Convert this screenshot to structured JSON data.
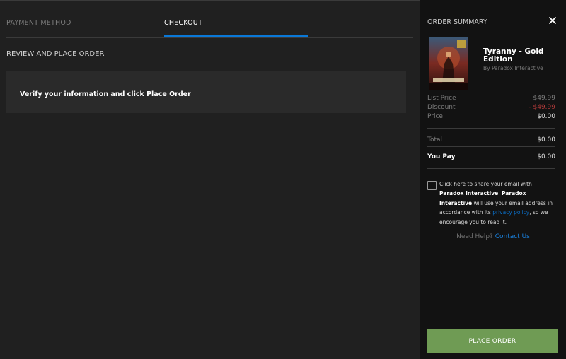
{
  "tabs": {
    "payment_method": "PAYMENT METHOD",
    "checkout": "CHECKOUT"
  },
  "review": {
    "title": "REVIEW AND PLACE ORDER",
    "verify_text": "Verify your information and click Place Order"
  },
  "summary": {
    "title": "ORDER SUMMARY",
    "close_icon": "close-icon",
    "game_title": "Tyranny - Gold Edition",
    "publisher": "By Paradox Interactive",
    "list_price_label": "List Price",
    "list_price_value": "$49.99",
    "discount_label": "Discount",
    "discount_value": "- $49.99",
    "price_label": "Price",
    "price_value": "$0.00",
    "total_label": "Total",
    "total_value": "$0.00",
    "you_pay_label": "You Pay",
    "you_pay_value": "$0.00"
  },
  "consent": {
    "text_1": "Click here to share your email with ",
    "company_1": "Paradox Interactive",
    "text_2": ". ",
    "company_2": "Paradox Interactive",
    "text_3": " will use your email address in accordance with its ",
    "privacy_link": "privacy policy",
    "text_4": ", so we encourage you to read it."
  },
  "help": {
    "label": "Need Help? ",
    "contact_link": "Contact Us"
  },
  "place_order_label": "PLACE ORDER",
  "colors": {
    "accent": "#0a78d7",
    "place_order": "#6f9b54",
    "discount": "#b33a3a"
  }
}
